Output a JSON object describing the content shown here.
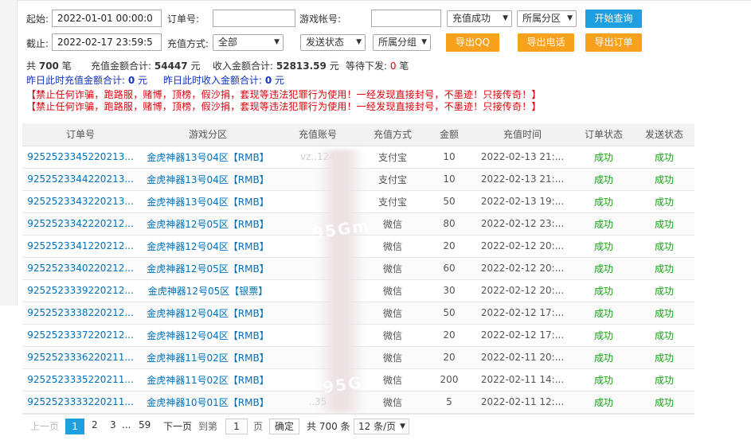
{
  "filters": {
    "start_label": "起始:",
    "start_value": "2022-01-01 00:00:0",
    "order_label": "订单号:",
    "order_value": "",
    "account_label": "游戏帐号:",
    "account_value": "",
    "recharge_status": "充值成功",
    "zone_select": "所属分区",
    "search_button": "开始查询",
    "end_label": "截止:",
    "end_value": "2022-02-17 23:59:5",
    "method_label": "充值方式:",
    "method_select": "全部",
    "send_status": "发送状态",
    "group_select": "所属分组",
    "export_qq": "导出QQ",
    "export_phone": "导出电话",
    "export_orders": "导出订单"
  },
  "stats": {
    "total_prefix": "共",
    "total_count": "700",
    "total_unit": "笔",
    "recharge_sum_label": "充值金额合计:",
    "recharge_sum": "54447",
    "yuan": "元",
    "income_sum_label": "收入金额合计:",
    "income_sum": "52813.59",
    "pending_label": "等待下发:",
    "pending_count": "0",
    "yesterday_recharge_label": "昨日此时充值金额合计:",
    "yesterday_recharge": "0",
    "yesterday_income_label": "昨日此时收入金额合计:",
    "yesterday_income": "0"
  },
  "warning": "【禁止任何诈骗，跑路服，赌博，顶榜，假沙捐，套现等违法犯罪行为使用！一经发现直接封号，不墨迹！只接传奇！】",
  "table": {
    "headers": [
      "订单号",
      "游戏分区",
      "充值账号",
      "充值方式",
      "金额",
      "充值时间",
      "订单状态",
      "发送状态"
    ],
    "rows": [
      [
        "9252523345220213...",
        "金虎神器13号04区【RMB】",
        "vz..124",
        "支付宝",
        "10",
        "2022-02-13 21:...",
        "成功",
        "成功"
      ],
      [
        "9252523344220213...",
        "金虎神器13号04区【RMB】",
        "",
        "支付宝",
        "10",
        "2022-02-13 21:...",
        "成功",
        "成功"
      ],
      [
        "9252523343220213...",
        "金虎神器13号04区【RMB】",
        "",
        "支付宝",
        "50",
        "2022-02-13 19:...",
        "成功",
        "成功"
      ],
      [
        "9252523342220212...",
        "金虎神器12号05区【RMB】",
        "",
        "微信",
        "80",
        "2022-02-12 23:...",
        "成功",
        "成功"
      ],
      [
        "9252523341220212...",
        "金虎神器12号04区【RMB】",
        "",
        "微信",
        "20",
        "2022-02-12 20:...",
        "成功",
        "成功"
      ],
      [
        "9252523340220212...",
        "金虎神器12号05区【RMB】",
        "",
        "微信",
        "60",
        "2022-02-12 20:...",
        "成功",
        "成功"
      ],
      [
        "9252523339220212...",
        "金虎神器12号05区【银票】",
        "",
        "微信",
        "30",
        "2022-02-12 20:...",
        "成功",
        "成功"
      ],
      [
        "9252523338220212...",
        "金虎神器12号04区【RMB】",
        "",
        "微信",
        "50",
        "2022-02-12 17:...",
        "成功",
        "成功"
      ],
      [
        "9252523337220212...",
        "金虎神器12号04区【RMB】",
        "",
        "微信",
        "20",
        "2022-02-12 17:...",
        "成功",
        "成功"
      ],
      [
        "9252523336220211...",
        "金虎神器11号02区【RMB】",
        "",
        "微信",
        "20",
        "2022-02-11 20:...",
        "成功",
        "成功"
      ],
      [
        "9252523335220211...",
        "金虎神器11号02区【RMB】",
        "",
        "微信",
        "200",
        "2022-02-11 14:...",
        "成功",
        "成功"
      ],
      [
        "9252523333220211...",
        "金虎神器10号01区【RMB】",
        "..35",
        "微信",
        "5",
        "2022-02-11 12:...",
        "成功",
        "成功"
      ]
    ]
  },
  "pager": {
    "prev": "上一页",
    "current": "1",
    "p2": "2",
    "p3": "3",
    "ellipsis": "...",
    "last": "59",
    "next": "下一页",
    "goto": "到第",
    "goto_value": "1",
    "page_unit": "页",
    "confirm": "确定",
    "total": "共 700 条",
    "per_page": "12 条/页"
  },
  "watermark": "95Gm",
  "colors": {
    "primary_blue": "#1e9fe0",
    "orange": "#f7a11c",
    "success_green": "#11a311",
    "warning_red": "#e0000a",
    "link_blue": "#0071bc"
  }
}
